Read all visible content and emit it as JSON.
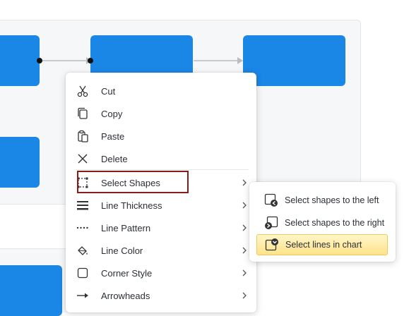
{
  "context_menu": {
    "items": [
      {
        "label": "Cut",
        "icon": "scissors-icon"
      },
      {
        "label": "Copy",
        "icon": "copy-icon"
      },
      {
        "label": "Paste",
        "icon": "paste-icon"
      },
      {
        "label": "Delete",
        "icon": "x-icon"
      },
      {
        "label": "Select Shapes",
        "icon": "dashed-square-icon"
      },
      {
        "label": "Line Thickness",
        "icon": "line-thickness-icon"
      },
      {
        "label": "Line Pattern",
        "icon": "dotted-line-icon"
      },
      {
        "label": "Line Color",
        "icon": "paint-bucket-icon"
      },
      {
        "label": "Corner Style",
        "icon": "rounded-square-icon"
      },
      {
        "label": "Arrowheads",
        "icon": "arrow-right-icon"
      }
    ]
  },
  "submenu": {
    "items": [
      {
        "label": "Select shapes to the left",
        "icon": "select-left-icon"
      },
      {
        "label": "Select shapes to the right",
        "icon": "select-right-icon"
      },
      {
        "label": "Select lines in chart",
        "icon": "select-lines-icon"
      }
    ]
  },
  "colors": {
    "shape_fill": "#1a86e6",
    "highlight_border": "#8b1c1c",
    "submenu_active": "#ffe38a"
  }
}
